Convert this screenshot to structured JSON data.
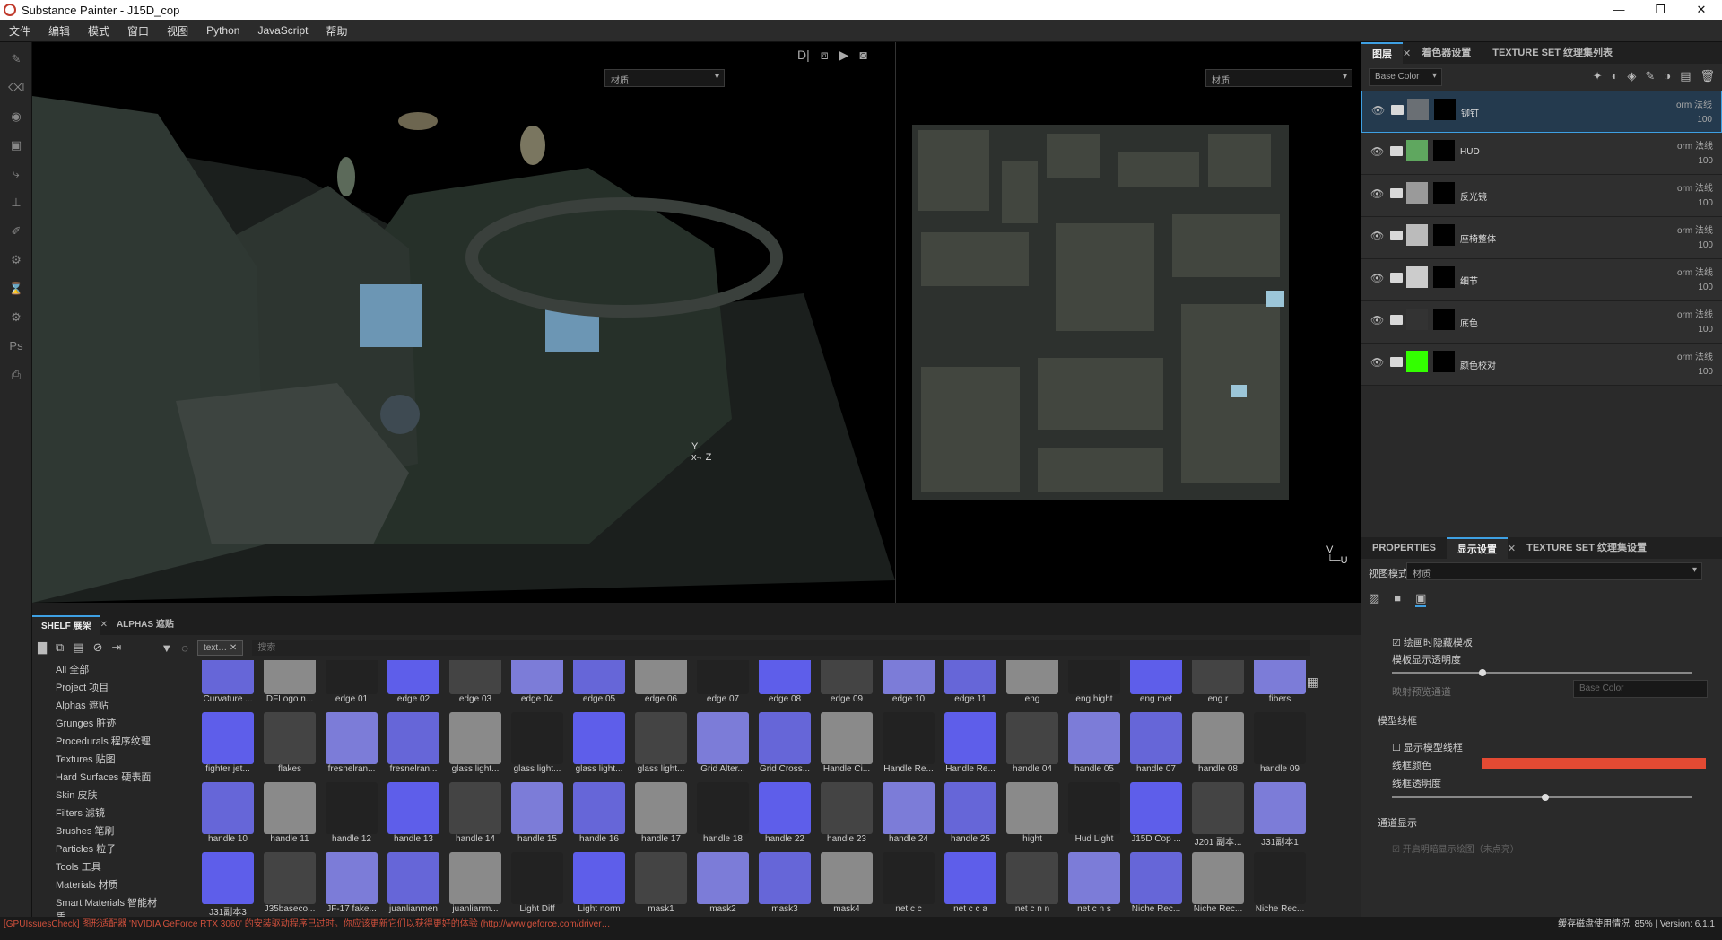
{
  "window": {
    "title": "Substance Painter - J15D_cop",
    "controls": [
      "—",
      "❐",
      "✕"
    ]
  },
  "menu": [
    "文件",
    "编辑",
    "模式",
    "窗口",
    "视图",
    "Python",
    "JavaScript",
    "帮助"
  ],
  "viewport": {
    "material_dropdown": "材质",
    "uv_dropdown": "材质"
  },
  "layers_panel": {
    "tabs": [
      "图层",
      "着色器设置",
      "TEXTURE SET 纹理集列表"
    ],
    "channel_select": "Base Color",
    "layers": [
      {
        "name": "铆钉",
        "blend": "orm 法线",
        "opacity": "100",
        "color": "#6a6f74",
        "selected": true
      },
      {
        "name": "HUD",
        "blend": "orm 法线",
        "opacity": "100",
        "color": "#5fa75f"
      },
      {
        "name": "反光镜",
        "blend": "orm 法线",
        "opacity": "100",
        "color": "#9a9a9a"
      },
      {
        "name": "座椅整体",
        "blend": "orm 法线",
        "opacity": "100",
        "color": "#bbbbbb"
      },
      {
        "name": "细节",
        "blend": "orm 法线",
        "opacity": "100",
        "color": "#cccccc"
      },
      {
        "name": "底色",
        "blend": "orm 法线",
        "opacity": "100",
        "color": "#333333"
      },
      {
        "name": "颜色校对",
        "blend": "orm 法线",
        "opacity": "100",
        "color": "#33ff00"
      }
    ]
  },
  "properties_panel": {
    "tabs": [
      "PROPERTIES",
      "显示设置",
      "TEXTURE SET 纹理集设置"
    ],
    "view_mode_label": "视图模式",
    "view_mode_value": "材质",
    "hide_on_paint": "绘画时隐藏模板",
    "template_opacity": "模板显示透明度",
    "template_opacity_value": 0.29,
    "map_channel_label": "映射预览通道",
    "map_channel_value": "Base Color",
    "wireframe_section": "模型线框",
    "show_wireframe": "显示模型线框",
    "wire_color_label": "线框颜色",
    "wire_color": "#e34a33",
    "wire_opacity_label": "线框透明度",
    "wire_opacity_value": 0.5,
    "channel_section": "通道显示",
    "truncated_option": "开启明暗显示绘图（未点亮）"
  },
  "shelf": {
    "tabs": [
      "SHELF 展架",
      "ALPHAS 遮贴"
    ],
    "filter_chip": "text…",
    "search_placeholder": "搜索",
    "categories": [
      "All 全部",
      "Project 项目",
      "Alphas 遮贴",
      "Grunges 脏迹",
      "Procedurals 程序纹理",
      "Textures 贴图",
      "Hard Surfaces 硬表面",
      "Skin 皮肤",
      "Filters 滤镜",
      "Brushes 笔刷",
      "Particles 粒子",
      "Tools 工具",
      "Materials 材质",
      "Smart Materials 智能材质"
    ],
    "rows": [
      [
        "Curvature ...",
        "DFLogo n...",
        "edge 01",
        "edge 02",
        "edge 03",
        "edge 04",
        "edge 05",
        "edge 06",
        "edge 07",
        "edge 08",
        "edge 09",
        "edge 10",
        "edge 11",
        "eng",
        "eng hight",
        "eng met",
        "eng r",
        "fibers"
      ],
      [
        "fighter jet...",
        "flakes",
        "fresnelran...",
        "fresnelran...",
        "glass light...",
        "glass light...",
        "glass light...",
        "glass light...",
        "Grid Alter...",
        "Grid Cross...",
        "Handle Ci...",
        "Handle Re...",
        "Handle Re...",
        "handle 04",
        "handle 05",
        "handle 07",
        "handle 08",
        "handle 09"
      ],
      [
        "handle 10",
        "handle 11",
        "handle 12",
        "handle 13",
        "handle 14",
        "handle 15",
        "handle 16",
        "handle 17",
        "handle 18",
        "handle 22",
        "handle 23",
        "handle 24",
        "handle 25",
        "hight",
        "Hud Light",
        "J15D Cop ...",
        "J201 副本...",
        "J31副本1"
      ],
      [
        "J31副本3",
        "J35baseco...",
        "JF-17 fake...",
        "juanlianmen",
        "juanlianm...",
        "Light Diff",
        "Light norm",
        "mask1",
        "mask2",
        "mask3",
        "mask4",
        "net c c",
        "net c c a",
        "net c n n",
        "net c n s",
        "Niche Rec...",
        "Niche Rec...",
        "Niche Rec..."
      ]
    ]
  },
  "statusbar": {
    "warning": "[GPUIssuesCheck] 图形适配器 'NVIDIA GeForce RTX 3060' 的安装驱动程序已过时。你应该更新它们以获得更好的体验 (http://www.geforce.com/driver…",
    "memory": "缓存磁盘使用情况: 85% | Version: 6.1.1"
  }
}
